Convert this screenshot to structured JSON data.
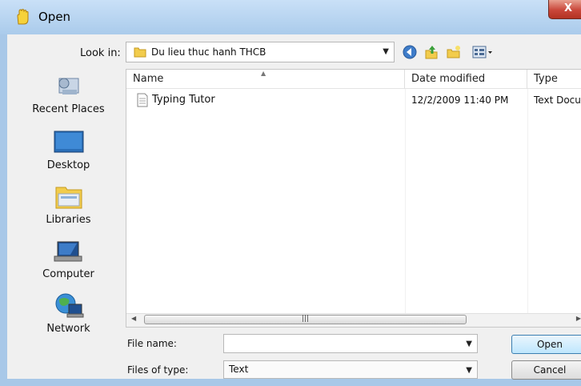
{
  "window": {
    "title": "Open",
    "close_label": "X"
  },
  "lookin": {
    "label": "Look in:",
    "value": "Du lieu thuc hanh THCB"
  },
  "places": [
    {
      "label": "Recent Places"
    },
    {
      "label": "Desktop"
    },
    {
      "label": "Libraries"
    },
    {
      "label": "Computer"
    },
    {
      "label": "Network"
    }
  ],
  "filelist": {
    "columns": [
      "Name",
      "Date modified",
      "Type"
    ],
    "rows": [
      {
        "name": "Typing Tutor",
        "date": "12/2/2009 11:40 PM",
        "type": "Text Docu"
      }
    ]
  },
  "form": {
    "filename_label": "File name:",
    "filename_value": "",
    "filetype_label": "Files of type:",
    "filetype_value": "Text"
  },
  "buttons": {
    "open": "Open",
    "cancel": "Cancel"
  },
  "icons": [
    "back-icon",
    "up-folder-icon",
    "new-folder-icon",
    "view-menu-icon"
  ]
}
